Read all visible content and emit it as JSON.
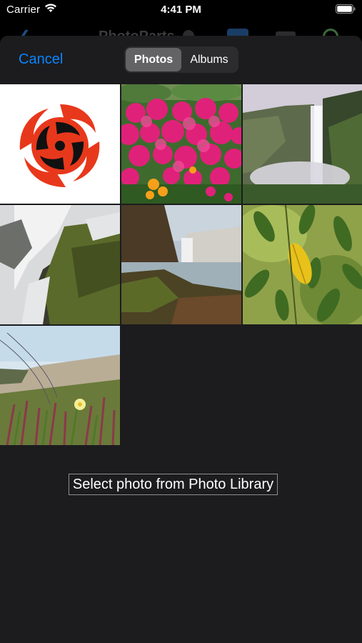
{
  "status_bar": {
    "carrier": "Carrier",
    "time": "4:41 PM",
    "icons": [
      "wifi-icon",
      "battery-icon"
    ]
  },
  "background_nav": {
    "title": "PhotoParts",
    "back_icon": "chevron-left-icon",
    "icons": [
      "person-icon",
      "folder-icon",
      "circle-icon"
    ]
  },
  "picker": {
    "cancel_label": "Cancel",
    "tabs": [
      {
        "label": "Photos",
        "selected": true
      },
      {
        "label": "Albums",
        "selected": false
      }
    ],
    "photos": [
      {
        "subject": "red logo on white",
        "kind": "logo"
      },
      {
        "subject": "pink and orange flowers",
        "kind": "flowers"
      },
      {
        "subject": "waterfall on green cliff",
        "kind": "waterfall-cliff"
      },
      {
        "subject": "long exposure waterfall over mossy rocks",
        "kind": "waterfall-rocks"
      },
      {
        "subject": "coastal waterfall with rocks",
        "kind": "coast-falls"
      },
      {
        "subject": "green leaves with yellow leaf",
        "kind": "leaves"
      },
      {
        "subject": "grass and yellow flower on dune",
        "kind": "dune"
      }
    ]
  },
  "footer": {
    "select_text": "Select photo from Photo Library"
  },
  "colors": {
    "accent": "#0a84ff",
    "sheet_background": "#1c1c1e",
    "segment_selected": "#636366",
    "segment_track": "#2c2c2e"
  }
}
